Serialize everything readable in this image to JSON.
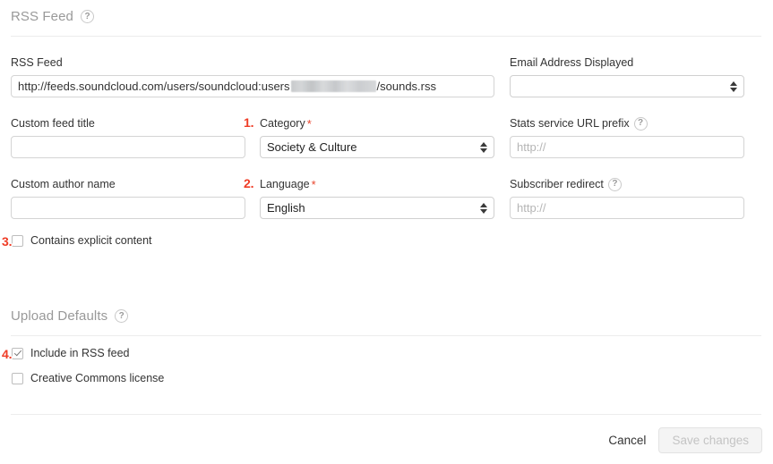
{
  "sections": {
    "rss": {
      "title": "RSS Feed",
      "help_icon": "?"
    },
    "upload": {
      "title": "Upload Defaults",
      "help_icon": "?"
    }
  },
  "fields": {
    "rss_feed": {
      "label": "RSS Feed",
      "value_prefix": "http://feeds.soundcloud.com/users/soundcloud:users",
      "value_suffix": "/sounds.rss",
      "redacted": true
    },
    "email_displayed": {
      "label": "Email Address Displayed",
      "value": ""
    },
    "custom_feed_title": {
      "label": "Custom feed title",
      "value": "",
      "placeholder": ""
    },
    "category": {
      "label": "Category",
      "required_mark": "*",
      "value": "Society & Culture"
    },
    "stats_url_prefix": {
      "label": "Stats service URL prefix",
      "help_icon": "?",
      "value": "",
      "placeholder": "http://"
    },
    "custom_author_name": {
      "label": "Custom author name",
      "value": "",
      "placeholder": ""
    },
    "language": {
      "label": "Language",
      "required_mark": "*",
      "value": "English"
    },
    "subscriber_redirect": {
      "label": "Subscriber redirect",
      "help_icon": "?",
      "value": "",
      "placeholder": "http://"
    }
  },
  "checkboxes": {
    "explicit": {
      "label": "Contains explicit content",
      "checked": false
    },
    "include_rss": {
      "label": "Include in RSS feed",
      "checked": true
    },
    "creative_commons": {
      "label": "Creative Commons license",
      "checked": false
    }
  },
  "markers": {
    "one": "1.",
    "two": "2.",
    "three": "3.",
    "four": "4."
  },
  "footer": {
    "cancel_label": "Cancel",
    "save_label": "Save changes"
  },
  "colors": {
    "marker_red": "#ef3c26",
    "required_red": "#e8432b",
    "section_title_gray": "#999999",
    "border_gray": "#d4d4d4",
    "placeholder_gray": "#b5b5b5"
  }
}
